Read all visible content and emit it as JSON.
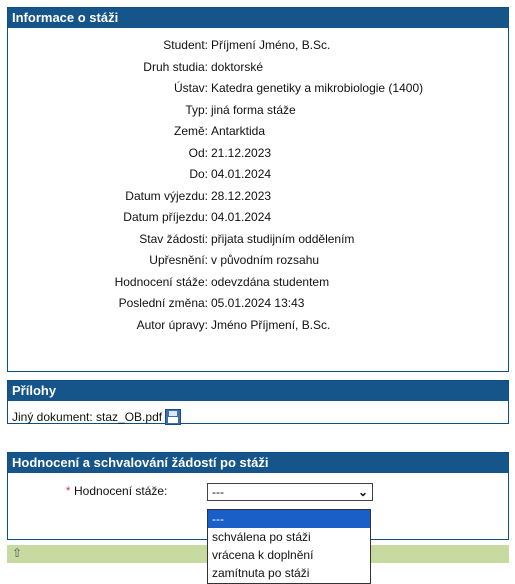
{
  "info_panel": {
    "title": "Informace o stáži",
    "rows": [
      {
        "label": "Student:",
        "value": "Příjmení Jméno, B.Sc."
      },
      {
        "label": "Druh studia:",
        "value": "doktorské"
      },
      {
        "label": "Ústav:",
        "value": "Katedra genetiky a mikrobiologie (1400)"
      },
      {
        "label": "Typ:",
        "value": "jiná forma stáže"
      },
      {
        "label": "Země:",
        "value": "Antarktida"
      },
      {
        "label": "Od:",
        "value": "21.12.2023"
      },
      {
        "label": "Do:",
        "value": "04.01.2024"
      },
      {
        "label": "Datum výjezdu:",
        "value": "28.12.2023"
      },
      {
        "label": "Datum příjezdu:",
        "value": "04.01.2024"
      },
      {
        "label": "Stav žádosti:",
        "value": "přijata studijním oddělením"
      },
      {
        "label": "Upřesnění:",
        "value": "v původním rozsahu"
      },
      {
        "label": "Hodnocení stáže:",
        "value": "odevzdána studentem"
      },
      {
        "label": "Poslední změna:",
        "value": "05.01.2024 13:43"
      },
      {
        "label": "Autor úpravy:",
        "value": "Jméno Příjmení, B.Sc."
      }
    ]
  },
  "attachments_panel": {
    "title": "Přílohy",
    "document_label": "Jiný dokument: staz_OB.pdf",
    "save_icon": "floppy-disk-icon"
  },
  "evaluation_panel": {
    "title": "Hodnocení a schvalování žádostí po stáži",
    "required_marker": "*",
    "field_label": "Hodnocení stáže:",
    "selected_value": "---",
    "arrow": "⌄",
    "options": [
      "---",
      "schválena po stáži",
      "vrácena k doplnění",
      "zamítnuta po stáži"
    ],
    "selected_index": 0
  },
  "footer": {
    "icon": "⇧"
  },
  "colors": {
    "header_bg": "#15558a",
    "dropdown_highlight": "#1a5ec8",
    "footer_bg": "#c7dba0",
    "required": "#dd2222"
  }
}
